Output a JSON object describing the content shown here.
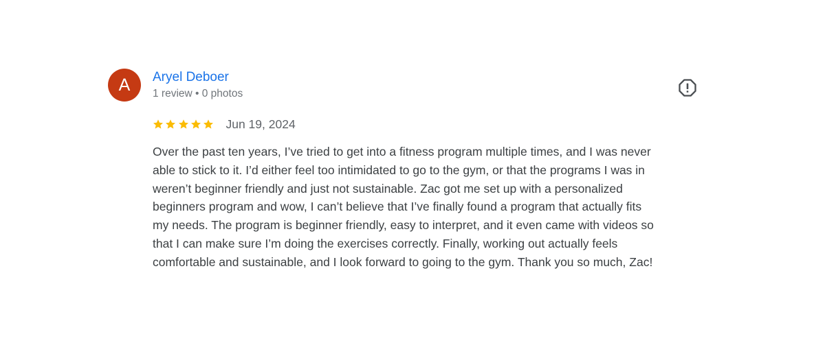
{
  "reviewer": {
    "initial": "A",
    "name": "Aryel Deboer",
    "meta": "1 review • 0 photos",
    "avatar_color": "#c53a13"
  },
  "review": {
    "rating": 5,
    "max_rating": 5,
    "date": "Jun 19, 2024",
    "text_lines": [
      "Over the past ten years, I’ve tried to get into a fitness program multiple times, and I was never",
      "able to stick to it. I’d either feel too intimidated to go to the gym, or that the programs I was in",
      "weren’t beginner friendly and just not sustainable. Zac got me set up with a personalized",
      "beginners program and wow, I can’t believe that I’ve finally found a program that actually fits",
      "my needs. The program is beginner friendly, easy to interpret, and it even came with videos so",
      "that I can make sure I’m doing the exercises correctly. Finally, working out actually feels",
      "comfortable and sustainable, and I look forward to going to the gym. Thank you so much, Zac!"
    ]
  },
  "icons": {
    "star": "star-icon",
    "report": "report-flag-icon"
  },
  "colors": {
    "name_link": "#1a73e8",
    "star": "#fbbc04",
    "meta_text": "#70757a",
    "body_text": "#3c4043"
  }
}
